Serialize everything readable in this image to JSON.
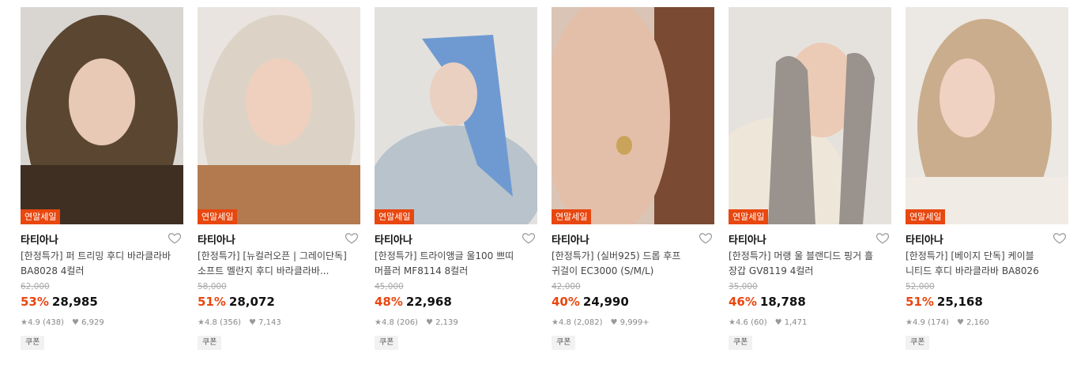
{
  "colors": {
    "accent": "#e8470f",
    "text": "#222222",
    "muted": "#888888"
  },
  "products": [
    {
      "badge": "연말세일",
      "brand": "타티아나",
      "title_line1": "[한정특가] 퍼 트리밍 후디 바라클라바",
      "title_line2": "BA8028 4컬러",
      "original_price": "62,000",
      "discount": "53%",
      "price": "28,985",
      "rating": "4.9",
      "reviews": "(438)",
      "likes": "6,929",
      "coupon": "쿠폰",
      "palette": {
        "bg": "#d9d6d2",
        "main": "#5b4632",
        "accent": "#3e2f22",
        "skin": "#e8c9b5"
      }
    },
    {
      "badge": "연말세일",
      "brand": "타티아나",
      "title_line1": "[한정특가] [뉴컬러오픈 | 그레이단독]",
      "title_line2": "소프트 멜란지 후디 바라클라바...",
      "original_price": "58,000",
      "discount": "51%",
      "price": "28,072",
      "rating": "4.8",
      "reviews": "(356)",
      "likes": "7,143",
      "coupon": "쿠폰",
      "palette": {
        "bg": "#e9e4df",
        "main": "#dcd3c6",
        "accent": "#b27a4e",
        "skin": "#efcfbd"
      }
    },
    {
      "badge": "연말세일",
      "brand": "타티아나",
      "title_line1": "[한정특가] 트라이앵글 울100 쁘띠",
      "title_line2": "머플러 MF8114 8컬러",
      "original_price": "45,000",
      "discount": "48%",
      "price": "22,968",
      "rating": "4.8",
      "reviews": "(206)",
      "likes": "2,139",
      "coupon": "쿠폰",
      "palette": {
        "bg": "#e3e1de",
        "main": "#6f9ad1",
        "accent": "#b9c3cc",
        "skin": "#ead0c0"
      }
    },
    {
      "badge": "연말세일",
      "brand": "타티아나",
      "title_line1": "[한정특가] (실버925) 드롭 후프",
      "title_line2": "귀걸이 EC3000 (S/M/L)",
      "original_price": "42,000",
      "discount": "40%",
      "price": "24,990",
      "rating": "4.8",
      "reviews": "(2,082)",
      "likes": "9,999+",
      "coupon": "쿠폰",
      "palette": {
        "bg": "#d9c4b6",
        "main": "#e3bfa9",
        "accent": "#7a4a33",
        "skin": "#e6c2ad"
      }
    },
    {
      "badge": "연말세일",
      "brand": "타티아나",
      "title_line1": "[한정특가] 머랭 울 블랜디드 핑거 흘",
      "title_line2": "장갑 GV8119 4컬러",
      "original_price": "35,000",
      "discount": "46%",
      "price": "18,788",
      "rating": "4.6",
      "reviews": "(60)",
      "likes": "1,471",
      "coupon": "쿠폰",
      "palette": {
        "bg": "#e5e2de",
        "main": "#9a928c",
        "accent": "#efe6da",
        "skin": "#eccbb6"
      }
    },
    {
      "badge": "연말세일",
      "brand": "타티아나",
      "title_line1": "[한정특가] [베이지 단독] 케이블",
      "title_line2": "니티드 후디 바라클라바 BA8026",
      "original_price": "52,000",
      "discount": "51%",
      "price": "25,168",
      "rating": "4.9",
      "reviews": "(174)",
      "likes": "2,160",
      "coupon": "쿠폰",
      "palette": {
        "bg": "#ece8e3",
        "main": "#c9ad8d",
        "accent": "#f0ebe4",
        "skin": "#efd2c2"
      }
    }
  ]
}
